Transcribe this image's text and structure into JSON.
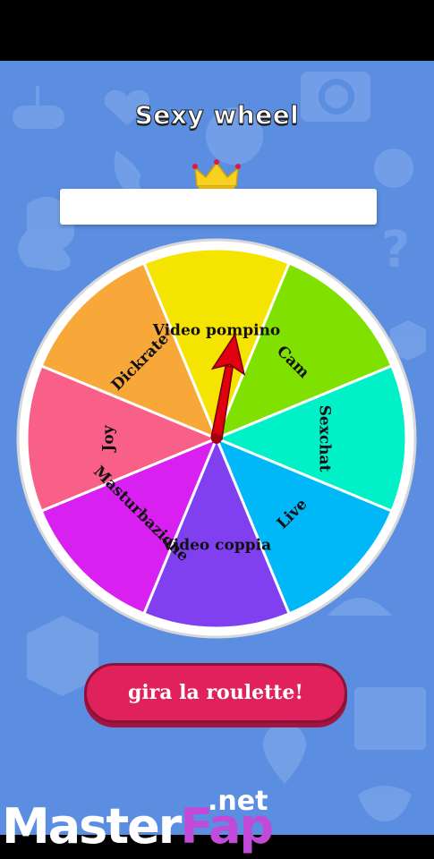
{
  "app": {
    "title": "Sexy wheel",
    "spin_button_label": "gira la roulette!",
    "result_value": ""
  },
  "wheel": {
    "segments": [
      {
        "label": "Video pompino",
        "color": "#f5e400"
      },
      {
        "label": "Cam",
        "color": "#80e000"
      },
      {
        "label": "Sexchat",
        "color": "#00f0c8"
      },
      {
        "label": "Live",
        "color": "#00b8f8"
      },
      {
        "label": "Video coppia",
        "color": "#8040f0"
      },
      {
        "label": "Masturbazione",
        "color": "#d820f0"
      },
      {
        "label": "Joy",
        "color": "#f86088"
      },
      {
        "label": "Dickrate",
        "color": "#f8a838"
      }
    ],
    "pointer_color": "#e00010"
  },
  "watermark": {
    "part1": "Master",
    "part2": "Fap",
    "suffix": ".net"
  },
  "colors": {
    "background": "#5b8de0",
    "button": "#e0215b"
  }
}
